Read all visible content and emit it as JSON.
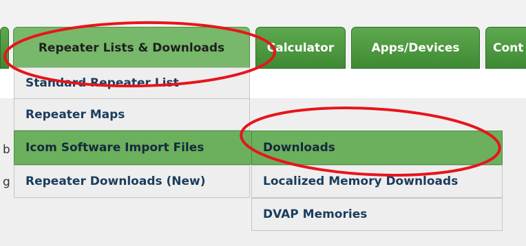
{
  "page_fragments": {
    "fragment_1": "b",
    "fragment_2": "g"
  },
  "nav": {
    "tabs": [
      {
        "label": "Repeater Lists & Downloads"
      },
      {
        "label": "Calculator"
      },
      {
        "label": "Apps/Devices"
      },
      {
        "label": "Cont"
      }
    ]
  },
  "menu": {
    "items": [
      {
        "label": "Standard Repeater List"
      },
      {
        "label": "Repeater Maps"
      },
      {
        "label": "Icom Software Import Files"
      },
      {
        "label": "Repeater Downloads (New)"
      }
    ],
    "submenu": [
      {
        "label": "Downloads"
      },
      {
        "label": "Localized Memory Downloads"
      },
      {
        "label": "DVAP Memories"
      }
    ]
  },
  "colors": {
    "tab_green": "#4a9a3f",
    "active_green": "#77b86a",
    "menu_bg": "#eeeeee",
    "highlight_green": "#6ab05d",
    "annotation_red": "#e8141c"
  }
}
